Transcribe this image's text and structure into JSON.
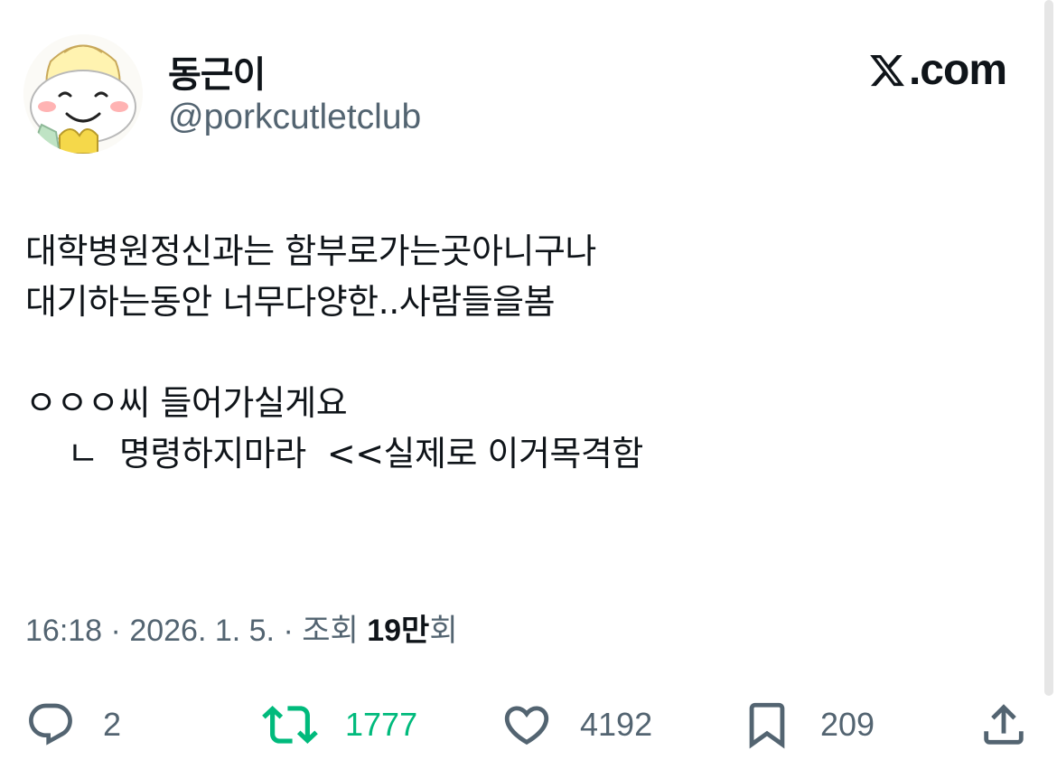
{
  "author": {
    "display_name": "동근이",
    "handle": "@porkcutletclub",
    "avatar": "cartoon-face-avatar"
  },
  "brand": {
    "label": ".com",
    "icon": "x-logo-icon"
  },
  "tweet": {
    "text": "대학병원정신과는 함부로가는곳아니구나\n대기하는동안 너무다양한..사람들을봄\n\nㅇㅇㅇ씨 들어가실게요\n    ㄴ  명령하지마라  <<실제로 이거목격함"
  },
  "meta": {
    "time": "16:18",
    "separator": " · ",
    "date": "2026. 1. 5.",
    "views_label": "조회 ",
    "views_count": "19만",
    "views_suffix": "회"
  },
  "actions": {
    "replies": {
      "icon": "reply-bubble-icon",
      "count": "2"
    },
    "retweets": {
      "icon": "retweet-icon",
      "count": "1777",
      "color": "#00ba7c"
    },
    "likes": {
      "icon": "heart-icon",
      "count": "4192"
    },
    "bookmarks": {
      "icon": "bookmark-icon",
      "count": "209"
    },
    "share": {
      "icon": "share-icon"
    }
  },
  "colors": {
    "text": "#0f1419",
    "secondary": "#536471",
    "retweet_green": "#00ba7c"
  }
}
